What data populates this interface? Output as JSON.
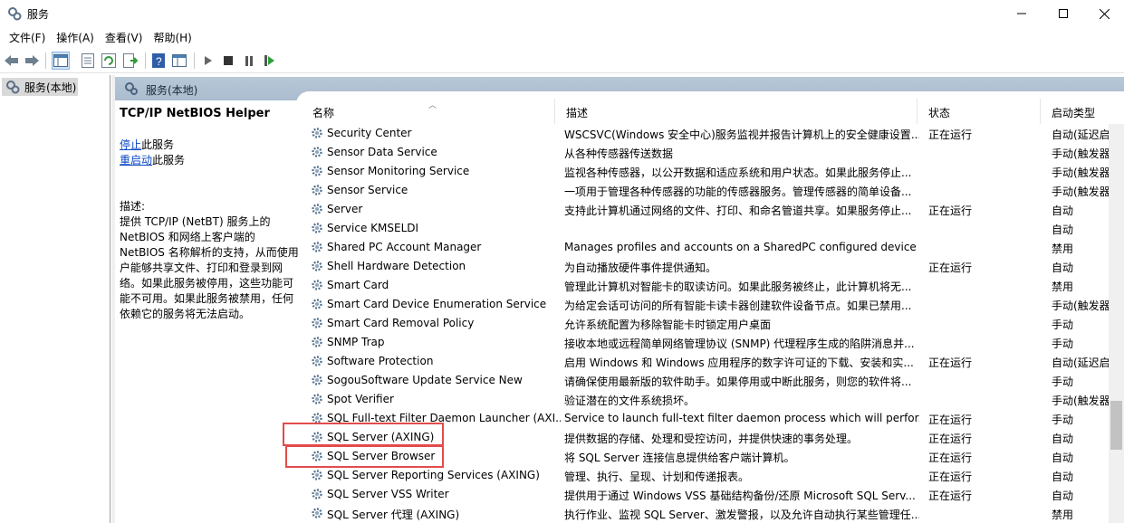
{
  "window": {
    "title": "服务"
  },
  "menu": [
    "文件(F)",
    "操作(A)",
    "查看(V)",
    "帮助(H)"
  ],
  "tree": {
    "root_label": "服务(本地)"
  },
  "panel": {
    "header_label": "服务(本地)",
    "selected_service": "TCP/IP NetBIOS Helper",
    "stop_link": "停止",
    "stop_suffix": "此服务",
    "restart_link": "重启动",
    "restart_suffix": "此服务",
    "desc_label": "描述:",
    "desc_lines": [
      "提供 TCP/IP (NetBT) 服务上的",
      "NetBIOS 和网络上客户端的",
      "NetBIOS 名称解析的支持，从而使用",
      "户能够共享文件、打印和登录到网",
      "络。如果此服务被停用，这些功能可",
      "能不可用。如果此服务被禁用，任何",
      "依赖它的服务将无法启动。"
    ]
  },
  "columns": {
    "name": "名称",
    "description": "描述",
    "status": "状态",
    "startup": "启动类型"
  },
  "services": [
    {
      "name": "Security Center",
      "description": "WSCSVC(Windows 安全中心)服务监视并报告计算机上的安全健康设置...",
      "status": "正在运行",
      "startup": "自动(延迟启"
    },
    {
      "name": "Sensor Data Service",
      "description": "从各种传感器传送数据",
      "status": "",
      "startup": "手动(触发器"
    },
    {
      "name": "Sensor Monitoring Service",
      "description": "监视各种传感器，以公开数据和适应系统和用户状态。如果此服务停止...",
      "status": "",
      "startup": "手动(触发器"
    },
    {
      "name": "Sensor Service",
      "description": "一项用于管理各种传感器的功能的传感器服务。管理传感器的简单设备...",
      "status": "",
      "startup": "手动(触发器"
    },
    {
      "name": "Server",
      "description": "支持此计算机通过网络的文件、打印、和命名管道共享。如果服务停止...",
      "status": "正在运行",
      "startup": "自动"
    },
    {
      "name": "Service KMSELDI",
      "description": "",
      "status": "",
      "startup": "自动"
    },
    {
      "name": "Shared PC Account Manager",
      "description": "Manages profiles and accounts on a SharedPC configured device",
      "status": "",
      "startup": "禁用"
    },
    {
      "name": "Shell Hardware Detection",
      "description": "为自动播放硬件事件提供通知。",
      "status": "正在运行",
      "startup": "自动"
    },
    {
      "name": "Smart Card",
      "description": "管理此计算机对智能卡的取读访问。如果此服务被终止，此计算机将无...",
      "status": "",
      "startup": "禁用"
    },
    {
      "name": "Smart Card Device Enumeration Service",
      "description": "为给定会话可访问的所有智能卡读卡器创建软件设备节点。如果已禁用...",
      "status": "",
      "startup": "手动(触发器"
    },
    {
      "name": "Smart Card Removal Policy",
      "description": "允许系统配置为移除智能卡时锁定用户桌面",
      "status": "",
      "startup": "手动"
    },
    {
      "name": "SNMP Trap",
      "description": "接收本地或远程简单网络管理协议 (SNMP) 代理程序生成的陷阱消息并...",
      "status": "",
      "startup": "手动"
    },
    {
      "name": "Software Protection",
      "description": "启用 Windows 和 Windows 应用程序的数字许可证的下载、安装和实...",
      "status": "正在运行",
      "startup": "自动(延迟启"
    },
    {
      "name": "SogouSoftware Update Service New",
      "description": "请确保使用最新版的软件助手。如果停用或中断此服务，则您的软件将...",
      "status": "",
      "startup": "手动"
    },
    {
      "name": "Spot Verifier",
      "description": "验证潜在的文件系统损坏。",
      "status": "",
      "startup": "手动(触发器"
    },
    {
      "name": "SQL Full-text Filter Daemon Launcher (AXI...",
      "description": "Service to launch full-text filter daemon process which will perfor...",
      "status": "正在运行",
      "startup": "手动"
    },
    {
      "name": "SQL Server (AXING)",
      "description": "提供数据的存储、处理和受控访问，并提供快速的事务处理。",
      "status": "正在运行",
      "startup": "自动"
    },
    {
      "name": "SQL Server Browser",
      "description": "将 SQL Server 连接信息提供给客户端计算机。",
      "status": "正在运行",
      "startup": "自动"
    },
    {
      "name": "SQL Server Reporting Services (AXING)",
      "description": "管理、执行、呈现、计划和传递报表。",
      "status": "正在运行",
      "startup": "自动"
    },
    {
      "name": "SQL Server VSS Writer",
      "description": "提供用于通过 Windows VSS 基础结构备份/还原 Microsoft SQL Serv...",
      "status": "正在运行",
      "startup": "自动"
    },
    {
      "name": "SQL Server 代理 (AXING)",
      "description": "执行作业、监视 SQL Server、激发警报，以及允许自动执行某些管理任...",
      "status": "",
      "startup": "禁用"
    }
  ],
  "highlight_color": "#e34b4b"
}
